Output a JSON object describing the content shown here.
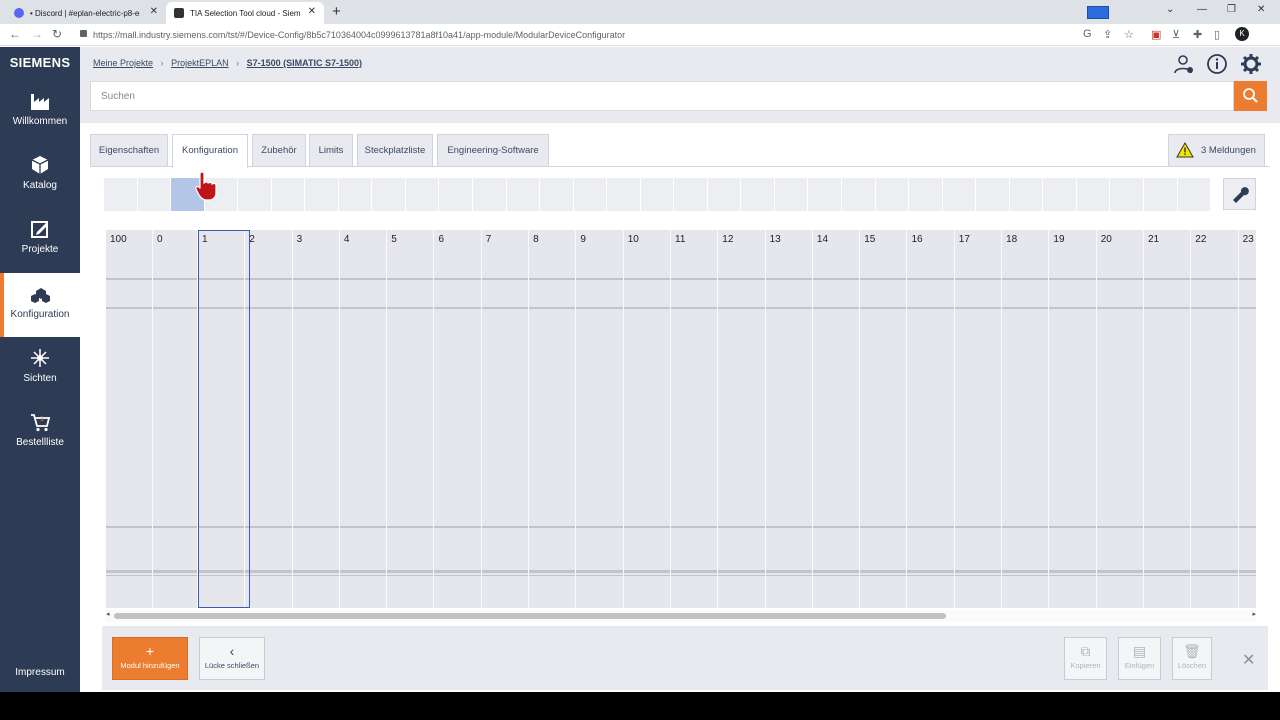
{
  "browser": {
    "tabs": [
      {
        "title": "• Discord | #eplan-electric-p8-er",
        "active": false,
        "favicon_color": "#5865f2"
      },
      {
        "title": "TIA Selection Tool cloud - Sieme",
        "active": true,
        "favicon_color": "#333333"
      }
    ],
    "url": "https://mall.industry.siemens.com/tst/#/Device-Config/8b5c710364004c0999613781a8f10a41/app-module/ModularDeviceConfigurator",
    "profile_initial": "K"
  },
  "sidebar": {
    "logo": "SIEMENS",
    "items": [
      {
        "label": "Willkommen",
        "icon": "factory-icon"
      },
      {
        "label": "Katalog",
        "icon": "cube-icon"
      },
      {
        "label": "Projekte",
        "icon": "edit-icon"
      },
      {
        "label": "Konfiguration",
        "icon": "cubes-icon",
        "active": true
      },
      {
        "label": "Sichten",
        "icon": "network-icon"
      },
      {
        "label": "Bestellliste",
        "icon": "cart-icon"
      }
    ],
    "footer": "Impressum"
  },
  "header": {
    "breadcrumb": [
      "Meine Projekte",
      "ProjektEPLAN",
      "S7-1500 (SIMATIC S7-1500)"
    ],
    "search_placeholder": "Suchen"
  },
  "tabs": [
    "Eigenschaften",
    "Konfiguration",
    "Zubehör",
    "Limits",
    "Steckplatzliste",
    "Engineering-Software"
  ],
  "active_tab": "Konfiguration",
  "messages_label": "3 Meldungen",
  "rack": {
    "slot_numbers": [
      "100",
      "0",
      "1",
      "2",
      "3",
      "4",
      "5",
      "6",
      "7",
      "8",
      "9",
      "10",
      "11",
      "12",
      "13",
      "14",
      "15",
      "16",
      "17",
      "18",
      "19",
      "20",
      "21",
      "22",
      "23"
    ],
    "selected_slot": "1"
  },
  "bottom": {
    "add_module": "Modul hinzufügen",
    "close_gap": "Lücke schließen",
    "copy": "Kopieren",
    "paste": "Einfügen",
    "delete": "Löschen"
  },
  "colors": {
    "sidebar_bg": "#2e3b55",
    "accent": "#ec7c2f",
    "selection": "#3b5bb5"
  }
}
